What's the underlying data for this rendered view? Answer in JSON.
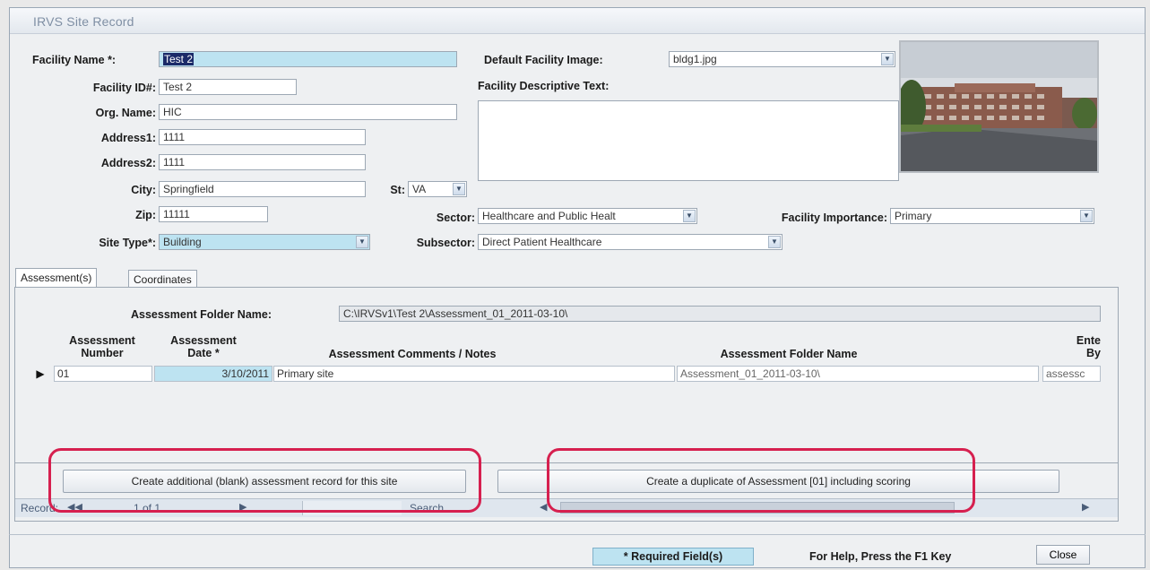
{
  "window": {
    "title": "IRVS Site Record"
  },
  "form": {
    "facility_name_label": "Facility Name *:",
    "facility_name_value": "Test 2",
    "facility_id_label": "Facility ID#:",
    "facility_id_value": "Test 2",
    "org_name_label": "Org. Name:",
    "org_name_value": "HIC",
    "address1_label": "Address1:",
    "address1_value": "1111",
    "address2_label": "Address2:",
    "address2_value": "1111",
    "city_label": "City:",
    "city_value": "Springfield",
    "state_label": "St:",
    "state_value": "VA",
    "zip_label": "Zip:",
    "zip_value": "11111",
    "site_type_label": "Site Type*:",
    "site_type_value": "Building",
    "default_image_label": "Default Facility Image:",
    "default_image_value": "bldg1.jpg",
    "descriptive_text_label": "Facility Descriptive Text:",
    "sector_label": "Sector:",
    "sector_value": "Healthcare and Public Healt",
    "subsector_label": "Subsector:",
    "subsector_value": "Direct Patient Healthcare",
    "importance_label": "Facility Importance:",
    "importance_value": "Primary"
  },
  "tabs": [
    {
      "label": "Assessment(s)"
    },
    {
      "label": "Coordinates"
    }
  ],
  "assessment": {
    "folder_name_label": "Assessment Folder Name:",
    "folder_name_value": "C:\\IRVSv1\\Test 2\\Assessment_01_2011-03-10\\",
    "columns": {
      "number_1": "Assessment",
      "number_2": "Number",
      "date_1": "Assessment",
      "date_2": "Date *",
      "comments": "Assessment Comments / Notes",
      "folder": "Assessment Folder Name",
      "entered_1": "Ente",
      "entered_2": "By"
    },
    "rows": [
      {
        "number": "01",
        "date": "3/10/2011",
        "comments": "Primary site",
        "folder": "Assessment_01_2011-03-10\\",
        "entered_by": "assessc"
      }
    ],
    "create_blank_button": "Create additional (blank) assessment record for this site",
    "duplicate_button": "Create a duplicate of Assessment [01] including scoring"
  },
  "navigation": {
    "record_label": "Record:",
    "record_position": "1 of 1",
    "search_label": "Search"
  },
  "footer": {
    "required_note": "* Required Field(s)",
    "help_text": "For Help, Press the F1 Key",
    "close_button": "Close"
  },
  "colors": {
    "required_field_bg": "#bde3f1",
    "highlight_ring": "#d6204f"
  }
}
